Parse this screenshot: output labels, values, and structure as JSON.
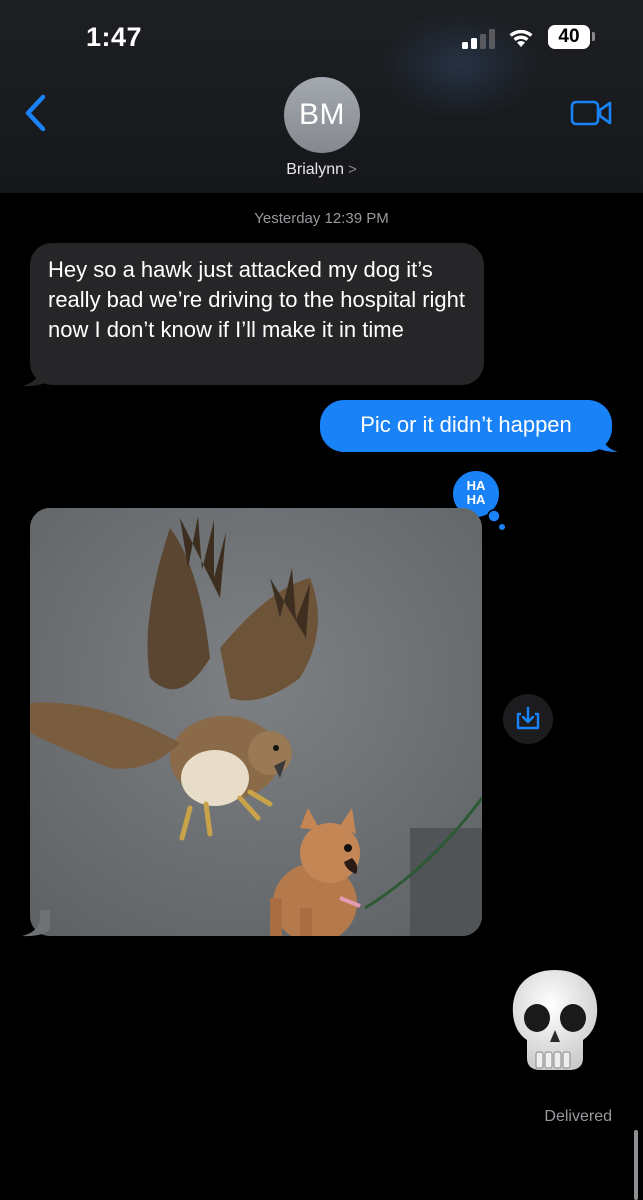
{
  "status_bar": {
    "time": "1:47",
    "battery": "40"
  },
  "header": {
    "avatar_initials": "BM",
    "contact_name": "Brialynn",
    "contact_chevron": ">",
    "back_icon": "chevron-left-icon",
    "video_icon": "video-camera-icon"
  },
  "conversation": {
    "timestamp": "Yesterday 12:39 PM",
    "messages": [
      {
        "direction": "incoming",
        "text": "Hey so a hawk just attacked my dog it’s really bad we’re driving to the hospital right now I don’t know if I’ll make it in time"
      },
      {
        "direction": "outgoing",
        "text": "Pic or it didn’t happen",
        "reaction": "haha"
      },
      {
        "direction": "incoming",
        "type": "image",
        "image_description_icon": "photo"
      },
      {
        "direction": "outgoing",
        "type": "emoji",
        "emoji": "skull"
      }
    ],
    "reaction_label": "HA HA",
    "delivered_label": "Delivered"
  },
  "colors": {
    "outgoing_bubble": "#1a82f7",
    "incoming_bubble": "#262628",
    "accent": "#1a82f7",
    "background": "#000000"
  }
}
